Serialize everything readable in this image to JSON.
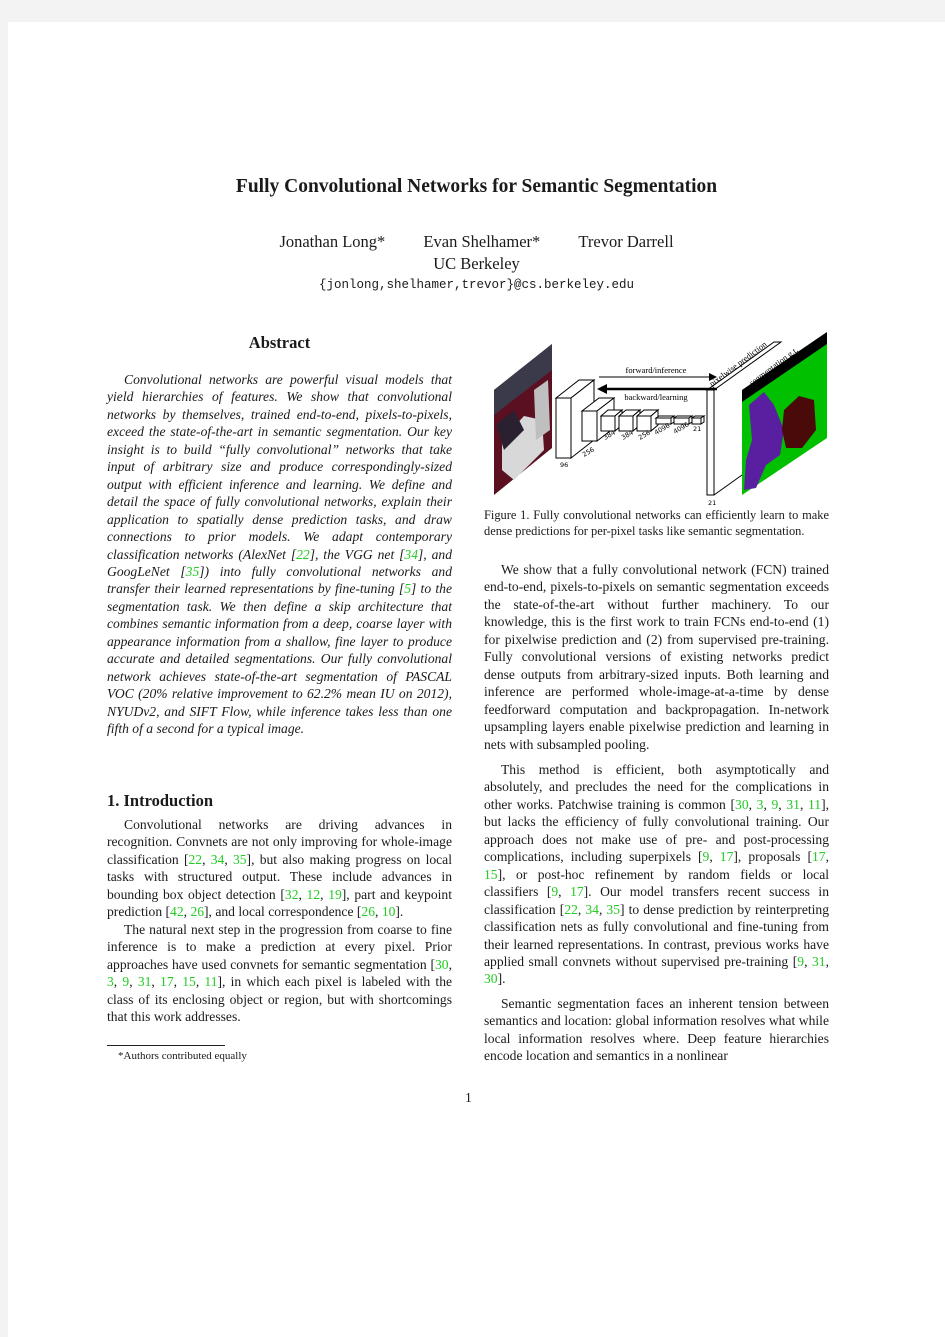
{
  "paper": {
    "title": "Fully Convolutional Networks for Semantic Segmentation",
    "authors": [
      "Jonathan Long*",
      "Evan Shelhamer*",
      "Trevor Darrell"
    ],
    "affiliation": "UC Berkeley",
    "email": "{jonlong,shelhamer,trevor}@cs.berkeley.edu",
    "page_number": "1"
  },
  "abstract": {
    "heading": "Abstract",
    "segments": [
      {
        "t": "Convolutional networks are powerful visual models that yield hierarchies of features.  We show that convolutional networks by themselves, trained end-to-end, pixels-to-pixels, exceed the state-of-the-art in semantic segmentation.  Our key insight is to build “fully convolutional” networks that take input of arbitrary size and produce correspondingly-sized output with efficient inference and learning. We define and detail the space of fully convolutional networks, explain their application to spatially dense prediction tasks, and draw connections to prior models. We adapt contemporary classification networks (AlexNet ["
      },
      {
        "c": "22"
      },
      {
        "t": "], the VGG net ["
      },
      {
        "c": "34"
      },
      {
        "t": "], and GoogLeNet ["
      },
      {
        "c": "35"
      },
      {
        "t": "]) into fully convolutional networks and transfer their learned representations by fine-tuning ["
      },
      {
        "c": "5"
      },
      {
        "t": "] to the segmentation task. We then define a skip architecture that combines semantic information from a deep, coarse layer with appearance information from a shallow, fine layer to produce accurate and detailed segmentations. Our fully convolutional network achieves state-of-the-art segmentation of PASCAL VOC (20% relative improvement to 62.2% mean IU on 2012), NYUDv2, and SIFT Flow, while inference takes less than one fifth of a second for a typical image."
      }
    ]
  },
  "introduction": {
    "heading": "1. Introduction",
    "paragraphs": [
      [
        {
          "t": "Convolutional networks are driving advances in recognition. Convnets are not only improving for whole-image classification ["
        },
        {
          "c": "22"
        },
        {
          "t": ", "
        },
        {
          "c": "34"
        },
        {
          "t": ", "
        },
        {
          "c": "35"
        },
        {
          "t": "], but also making progress on local tasks with structured output.  These include advances in bounding box object detection ["
        },
        {
          "c": "32"
        },
        {
          "t": ", "
        },
        {
          "c": "12"
        },
        {
          "t": ", "
        },
        {
          "c": "19"
        },
        {
          "t": "], part and keypoint prediction ["
        },
        {
          "c": "42"
        },
        {
          "t": ", "
        },
        {
          "c": "26"
        },
        {
          "t": "], and local correspondence ["
        },
        {
          "c": "26"
        },
        {
          "t": ", "
        },
        {
          "c": "10"
        },
        {
          "t": "]."
        }
      ],
      [
        {
          "t": "The natural next step in the progression from coarse to fine inference is to make a prediction at every pixel. Prior approaches have used convnets for semantic segmentation ["
        },
        {
          "c": "30"
        },
        {
          "t": ", "
        },
        {
          "c": "3"
        },
        {
          "t": ", "
        },
        {
          "c": "9"
        },
        {
          "t": ", "
        },
        {
          "c": "31"
        },
        {
          "t": ", "
        },
        {
          "c": "17"
        },
        {
          "t": ", "
        },
        {
          "c": "15"
        },
        {
          "t": ", "
        },
        {
          "c": "11"
        },
        {
          "t": "], in which each pixel is labeled with the class of its enclosing object or region, but with shortcomings that this work addresses."
        }
      ]
    ],
    "footnote": "*Authors contributed equally"
  },
  "figure1": {
    "caption": "Figure 1.   Fully convolutional networks can efficiently learn to make dense predictions for per-pixel tasks like semantic segmentation.",
    "forward_label": "forward/inference",
    "backward_label": "backward/learning",
    "prediction_label": "pixelwise prediction",
    "gt_label": "segmentation g.t.",
    "layer_labels": [
      "96",
      "256",
      "384",
      "384",
      "256",
      "4096",
      "4096",
      "21"
    ],
    "output_label": "21",
    "colors": {
      "background": "#00c000",
      "person": "#5a1fa0",
      "cat": "#4a0a0a",
      "border": "#000000"
    }
  },
  "right_column": {
    "paragraphs": [
      [
        {
          "t": "We show that a fully convolutional network (FCN) trained end-to-end, pixels-to-pixels on semantic segmentation exceeds the state-of-the-art without further machinery. To our knowledge, this is the first work to train FCNs end-to-end (1) for pixelwise prediction and (2) from supervised pre-training. Fully convolutional versions of existing networks predict dense outputs from arbitrary-sized inputs. Both learning and inference are performed whole-image-at-a-time by dense feedforward computation and backpropagation. In-network upsampling layers enable pixelwise prediction and learning in nets with subsampled pooling."
        }
      ],
      [
        {
          "t": "This method is efficient, both asymptotically and absolutely, and precludes the need for the complications in other works. Patchwise training is common ["
        },
        {
          "c": "30"
        },
        {
          "t": ", "
        },
        {
          "c": "3"
        },
        {
          "t": ", "
        },
        {
          "c": "9"
        },
        {
          "t": ", "
        },
        {
          "c": "31"
        },
        {
          "t": ", "
        },
        {
          "c": "11"
        },
        {
          "t": "], but lacks the efficiency of fully convolutional training. Our approach does not make use of pre- and post-processing complications, including superpixels ["
        },
        {
          "c": "9"
        },
        {
          "t": ", "
        },
        {
          "c": "17"
        },
        {
          "t": "], proposals ["
        },
        {
          "c": "17"
        },
        {
          "t": ", "
        },
        {
          "c": "15"
        },
        {
          "t": "], or post-hoc refinement by random fields or local classifiers ["
        },
        {
          "c": "9"
        },
        {
          "t": ", "
        },
        {
          "c": "17"
        },
        {
          "t": "].  Our model transfers recent success in classification ["
        },
        {
          "c": "22"
        },
        {
          "t": ", "
        },
        {
          "c": "34"
        },
        {
          "t": ", "
        },
        {
          "c": "35"
        },
        {
          "t": "] to dense prediction by reinterpreting classification nets as fully convolutional and fine-tuning from their learned representations.  In contrast, previous works have applied small convnets without supervised pre-training ["
        },
        {
          "c": "9"
        },
        {
          "t": ", "
        },
        {
          "c": "31"
        },
        {
          "t": ", "
        },
        {
          "c": "30"
        },
        {
          "t": "]."
        }
      ],
      [
        {
          "t": "Semantic segmentation faces an inherent tension between semantics and location: global information resolves what while local information resolves where. Deep feature hierarchies encode location and semantics in a nonlinear"
        }
      ]
    ]
  },
  "theme": {
    "citation_color": "#22cc22",
    "page_bg": "#ffffff",
    "viewer_bg": "#f3f3f3"
  }
}
